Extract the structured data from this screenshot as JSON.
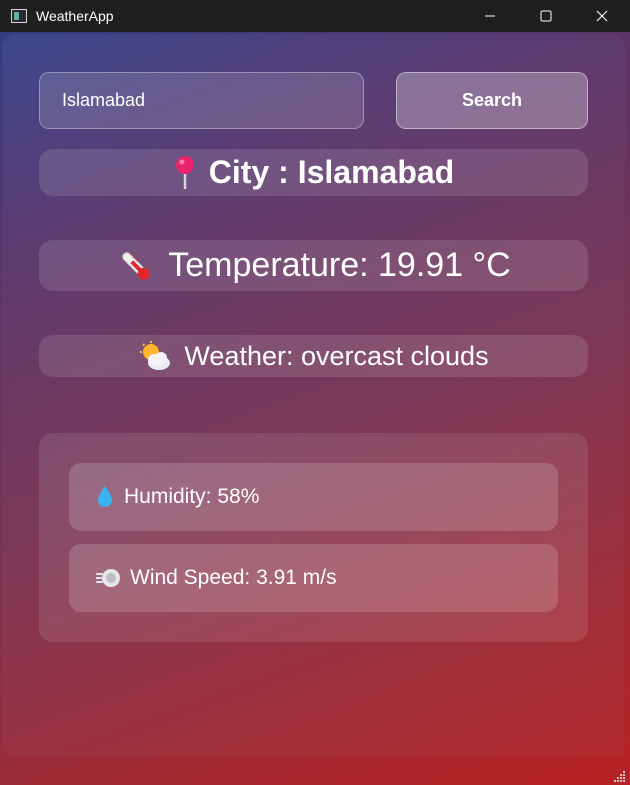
{
  "titlebar": {
    "app_title": "WeatherApp",
    "buttons": [
      "minimize-icon",
      "maximize-icon",
      "close-icon"
    ]
  },
  "search": {
    "input_value": "Islamabad",
    "button_label": "Search"
  },
  "city": {
    "icon": "pin-icon",
    "text": "City : Islamabad"
  },
  "temperature": {
    "icon": "thermometer-icon",
    "text": "Temperature: 19.91 °C"
  },
  "weather": {
    "icon": "sun-behind-cloud-icon",
    "text": "Weather: overcast clouds"
  },
  "details": {
    "humidity": {
      "icon": "droplet-icon",
      "text": "Humidity: 58%"
    },
    "wind": {
      "icon": "wind-icon",
      "text": "Wind Speed: 3.91 m/s"
    }
  },
  "colors": {
    "gradient_start": "#2c3f86",
    "gradient_end": "#b82222",
    "pin": "#e8246b",
    "droplet": "#3ab2f0"
  }
}
